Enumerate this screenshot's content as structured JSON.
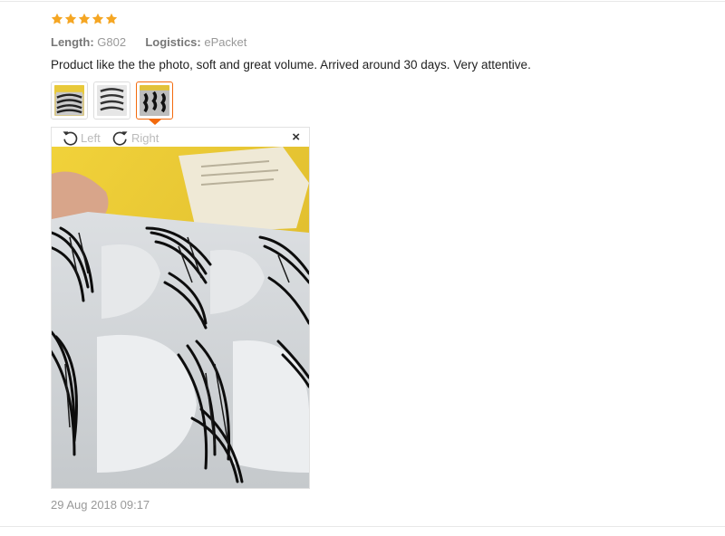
{
  "rating": {
    "stars": 5,
    "max": 5,
    "color": "#f5a623"
  },
  "meta": {
    "length_label": "Length:",
    "length_value": "G802",
    "logistics_label": "Logistics:",
    "logistics_value": "ePacket"
  },
  "review_text": "Product like the the photo, soft and great volume. Arrived around 30 days. Very attentive.",
  "thumbnails": {
    "count": 3,
    "selected_index": 2,
    "accent": "#f36a0d"
  },
  "viewer": {
    "rotate_left_label": "Left",
    "rotate_right_label": "Right",
    "close_label": "×"
  },
  "date": "29 Aug 2018 09:17"
}
